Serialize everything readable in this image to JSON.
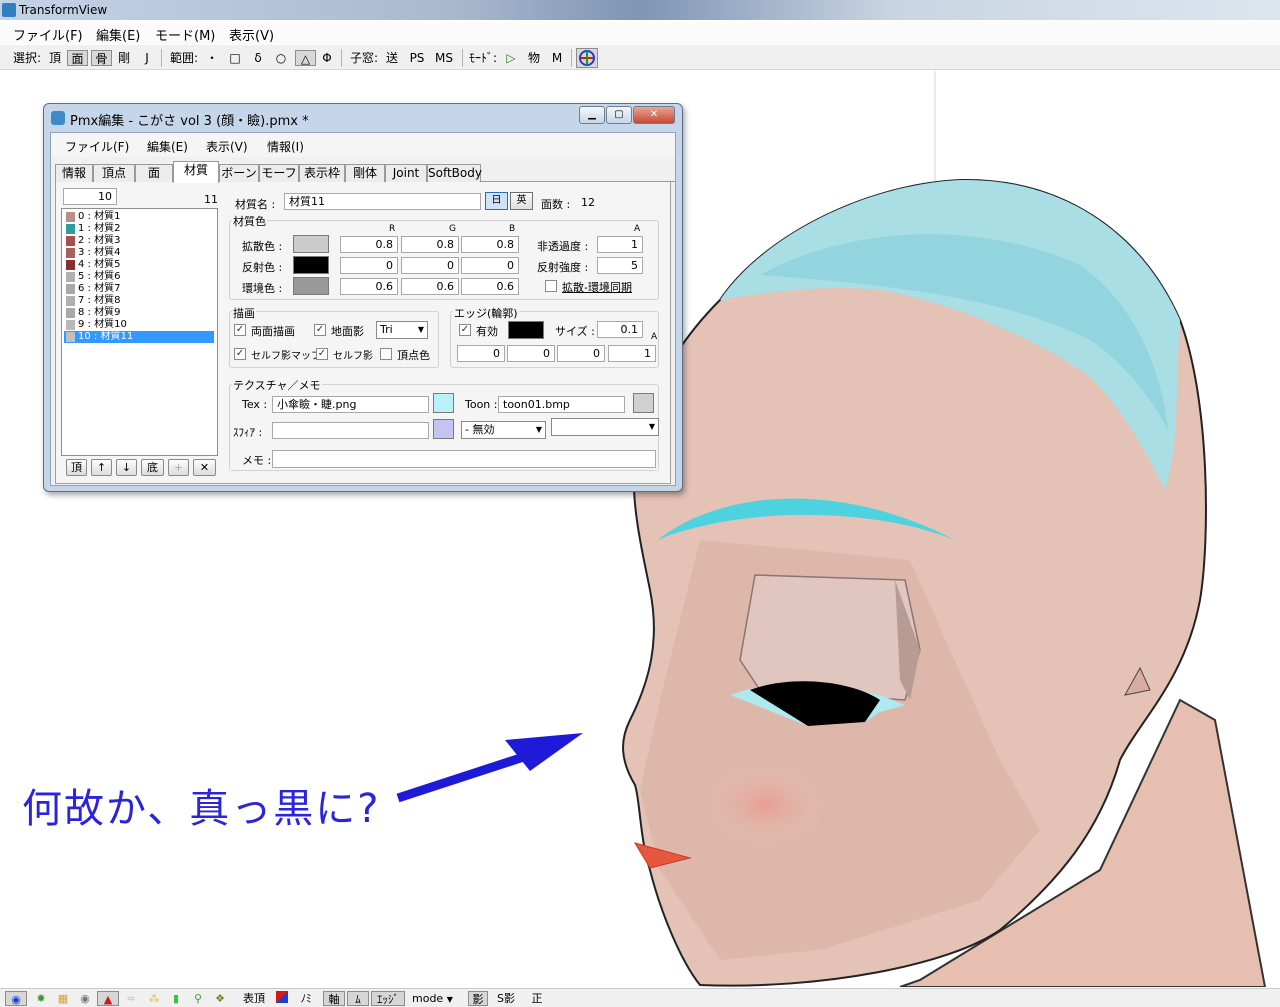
{
  "window": {
    "title": "TransformView"
  },
  "menubar": [
    "ファイル(F)",
    "編集(E)",
    "モード(M)",
    "表示(V)"
  ],
  "toolbar": {
    "select_label": "選択:",
    "select_items": [
      "頂",
      "面",
      "骨",
      "剛",
      "J"
    ],
    "range_label": "範囲:",
    "range_items": [
      "・",
      "□",
      "δ",
      "○",
      "△",
      "Φ"
    ],
    "child_label": "子窓:",
    "child_items": [
      "送",
      "PS",
      "MS"
    ],
    "mode_label": "ﾓｰﾄﾞ:",
    "mode_items": [
      "▷",
      "物",
      "M"
    ]
  },
  "annotation": "何故か、真っ黒に?",
  "dialog": {
    "title": "Pmx編集 - こがさ vol 3 (顔・瞼).pmx *",
    "menus": [
      "ファイル(F)",
      "編集(E)",
      "表示(V)",
      "情報(I)"
    ],
    "tabs": [
      "情報",
      "頂点",
      "面",
      "材質",
      "ボーン",
      "モーフ",
      "表示枠",
      "剛体",
      "Joint",
      "SoftBody"
    ],
    "active_tab": "材質",
    "list_index": "10",
    "list_count": "11",
    "materials": [
      {
        "label": "0 : 材質1",
        "color": "#b89088"
      },
      {
        "label": "1 : 材質2",
        "color": "#2e9e9e"
      },
      {
        "label": "2 : 材質3",
        "color": "#a85050"
      },
      {
        "label": "3 : 材質4",
        "color": "#a86060"
      },
      {
        "label": "4 : 材質5",
        "color": "#8a2f2f"
      },
      {
        "label": "5 : 材質6",
        "color": "#b0b0b0"
      },
      {
        "label": "6 : 材質7",
        "color": "#a8a8a8"
      },
      {
        "label": "7 : 材質8",
        "color": "#b0b0b0"
      },
      {
        "label": "8 : 材質9",
        "color": "#a8a8a8"
      },
      {
        "label": "9 : 材質10",
        "color": "#b8b8b8"
      },
      {
        "label": "10 : 材質11",
        "color": "#c0c0c0"
      }
    ],
    "selected_index": 10,
    "list_buttons": [
      "頂",
      "↑",
      "↓",
      "底",
      "+",
      "✕"
    ],
    "mat_name_label": "材質名 :",
    "mat_name_value": "材質11",
    "lang_jp": "日",
    "lang_en": "英",
    "face_count_label": "面数 :",
    "face_count": "12",
    "color_group": "材質色",
    "col_R": "R",
    "col_G": "G",
    "col_B": "B",
    "col_A": "A",
    "diffuse_label": "拡散色 :",
    "diffuse": [
      "0.8",
      "0.8",
      "0.8"
    ],
    "diffuse_color": "#cccccc",
    "alpha_label": "非透過度 :",
    "alpha": "1",
    "specular_label": "反射色 :",
    "specular": [
      "0",
      "0",
      "0"
    ],
    "specular_color": "#000000",
    "spec_power_label": "反射強度 :",
    "spec_power": "5",
    "ambient_label": "環境色 :",
    "ambient": [
      "0.6",
      "0.6",
      "0.6"
    ],
    "ambient_color": "#999999",
    "sync_label": "拡散-環境同期",
    "draw_group": "描画",
    "double_sided": "両面描画",
    "ground_shadow": "地面影",
    "tri": "Tri",
    "self_shadow_map": "セルフ影マップ",
    "self_shadow": "セルフ影",
    "vertex_color": "頂点色",
    "edge_group": "エッジ(輪郭)",
    "edge_enabled": "有効",
    "edge_color": "#000000",
    "edge_size_label": "サイズ :",
    "edge_size": "0.1",
    "edge_rgba": [
      "0",
      "0",
      "0",
      "1"
    ],
    "edge_a": "A",
    "tex_group": "テクスチャ／メモ",
    "tex_label": "Tex :",
    "tex_value": "小傘瞼・睫.png",
    "tex_swatch": "#b8f2f8",
    "toon_label": "Toon :",
    "toon_value": "toon01.bmp",
    "toon_swatch": "#d0d0d0",
    "sphere_label": "ｽﾌｨｱ :",
    "sphere_value": "",
    "sphere_swatch": "#c4c4f4",
    "sphere_mode": "- 無効",
    "memo_label": "メモ :",
    "memo_value": ""
  },
  "statusbar": {
    "items": [
      "表頂",
      "ﾉﾐ",
      "軸",
      "ﾑ",
      "ｴｯｼﾞ",
      "mode",
      "影",
      "S影",
      "正"
    ]
  }
}
